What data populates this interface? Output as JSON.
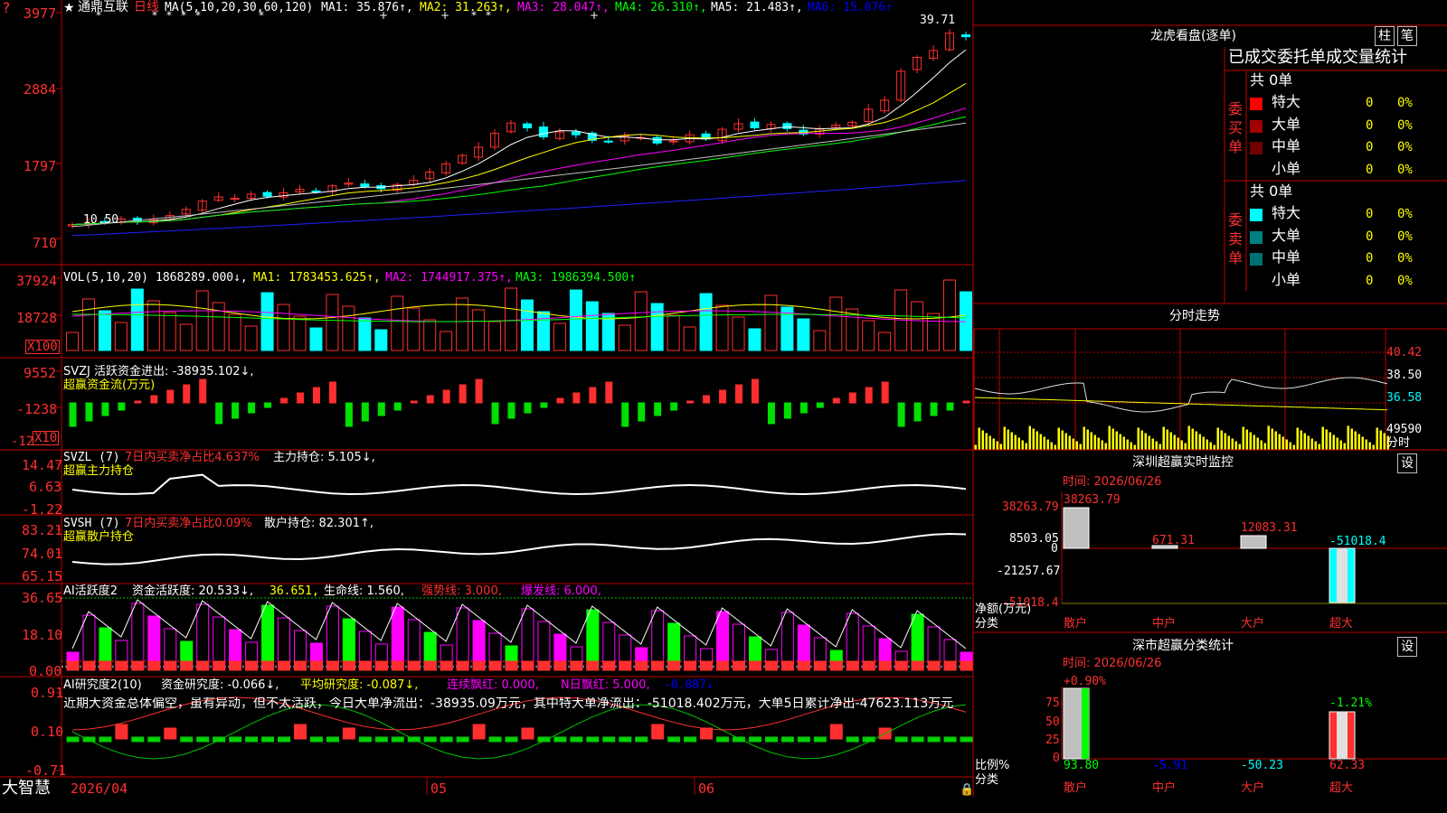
{
  "app": {
    "brand": "大智慧",
    "corner_mark": "?",
    "lock_icon": "lock-icon"
  },
  "header": {
    "star": "★",
    "stock_name": "通鼎互联",
    "period": "日线",
    "ma_label": "MA(5,10,20,30,60,120)",
    "ma1": "MA1: 35.876↑,",
    "ma2": "MA2: 31.263↑,",
    "ma3": "MA3: 28.047↑,",
    "ma4": "MA4: 26.310↑,",
    "ma5": "MA5: 21.483↑,",
    "ma6": "MA6: 15.076↑",
    "high_label": "39.71",
    "low_label": "10.50"
  },
  "price_axis": [
    "3977",
    "2884",
    "1797",
    "710"
  ],
  "vol_panel": {
    "title": "VOL(5,10,20)",
    "value": "1868289.000↓,",
    "ma1": "MA1: 1783453.625↑,",
    "ma2": "MA2: 1744917.375↑,",
    "ma3": "MA3: 1986394.500↑",
    "axis": [
      "37924",
      "18728"
    ],
    "unit": "X100"
  },
  "svzj_panel": {
    "title": "SVZJ  活跃资金进出: -38935.102↓,",
    "subtitle": "超赢资金流(万元)",
    "axis": [
      "9552",
      "-1238",
      "-12"
    ],
    "unit": "X10"
  },
  "svzl_panel": {
    "title": "SVZL (7)",
    "desc": "7日内买卖净占比4.637%",
    "hold": "主力持仓: 5.105↓,",
    "subtitle": "超赢主力持仓",
    "axis": [
      "14.47",
      "6.63",
      "-1.22"
    ]
  },
  "svsh_panel": {
    "title": "SVSH (7)",
    "desc": "7日内买卖净占比0.09%",
    "hold": "散户持仓: 82.301↑,",
    "subtitle": "超赢散户持仓",
    "axis": [
      "83.21",
      "74.01",
      "65.15"
    ]
  },
  "ai_active_panel": {
    "title": "AI活跃度2",
    "v1": "资金活跃度: 20.533↓,",
    "v2": "36.651,",
    "v3": "生命线: 1.560,",
    "v4": "强势线: 3.000,",
    "v5": "爆发线: 6.000,",
    "axis": [
      "36.65",
      "18.10",
      "0.00"
    ]
  },
  "ai_research_panel": {
    "title": "AI研究度2(10)",
    "v1": "资金研究度: -0.066↓,",
    "v2": "平均研究度: -0.087↓,",
    "v3": "连续飘红: 0.000,",
    "v4": "N日飘红: 5.000,",
    "v5": "-0.087↓",
    "note": "近期大资金总体偏空，虽有异动，但不太活跃，今日大单净流出：-38935.09万元，其中特大单净流出：-51018.402万元，大单5日累计净出-47623.113万元",
    "axis": [
      "0.91",
      "0.10",
      "-0.71"
    ]
  },
  "date_axis": [
    "2026/04",
    "05",
    "06"
  ],
  "right": {
    "lhb_title": "龙虎看盘(逐单)",
    "btn_zhu": "柱",
    "btn_bi": "笔",
    "stats_title": "已成交委托单成交量统计",
    "buy_label": "委买单",
    "sell_label": "委卖单",
    "buy_total": "共 0单",
    "sell_total": "共 0单",
    "buy_rows": [
      {
        "label": "特大",
        "count": "0",
        "pct": "0%",
        "color": "#ff0000"
      },
      {
        "label": "大单",
        "count": "0",
        "pct": "0%",
        "color": "#a00000"
      },
      {
        "label": "中单",
        "count": "0",
        "pct": "0%",
        "color": "#700000"
      },
      {
        "label": "小单",
        "count": "0",
        "pct": "0%",
        "color": ""
      }
    ],
    "sell_rows": [
      {
        "label": "特大",
        "count": "0",
        "pct": "0%",
        "color": "#00ffff"
      },
      {
        "label": "大单",
        "count": "0",
        "pct": "0%",
        "color": "#008080"
      },
      {
        "label": "中单",
        "count": "0",
        "pct": "0%",
        "color": "#007070"
      },
      {
        "label": "小单",
        "count": "0",
        "pct": "0%",
        "color": ""
      }
    ],
    "intraday_title": "分时走势",
    "intraday_axis": [
      "40.42",
      "38.50",
      "36.58",
      "49590"
    ],
    "intraday_footer": "分时",
    "sz_monitor_title": "深圳超赢实时监控",
    "sz_monitor_btn": "设",
    "sz_monitor_time": "时间: 2026/06/26",
    "sz_monitor_axis": [
      "38263.79",
      "8503.05",
      "0",
      "-21257.67",
      "-51018.4"
    ],
    "sz_monitor_values": [
      "38263.79",
      "671.31",
      "12083.31",
      "-51018.4"
    ],
    "sz_monitor_ylabel": "净额(万元)",
    "sz_monitor_xlabel": "分类",
    "categories": [
      "散户",
      "中户",
      "大户",
      "超大"
    ],
    "sz_class_title": "深市超赢分类统计",
    "sz_class_btn": "设",
    "sz_class_time": "时间: 2026/06/26",
    "sz_class_axis": [
      "75",
      "50",
      "25",
      "0"
    ],
    "sz_class_top": [
      "+0.90%",
      "-1.21%"
    ],
    "sz_class_values": [
      "93.80",
      "-5.91",
      "-50.23",
      "62.33"
    ],
    "sz_class_ylabel": "比例%",
    "sz_class_xlabel": "分类"
  },
  "chart_data": {
    "type": "candlestick",
    "title": "通鼎互联 日线",
    "close": [
      10.8,
      11.0,
      11.2,
      11.6,
      11.3,
      11.5,
      12.1,
      13.0,
      14.2,
      14.8,
      14.6,
      15.2,
      14.9,
      15.4,
      15.9,
      15.6,
      16.4,
      16.8,
      16.3,
      16.0,
      16.6,
      17.2,
      18.4,
      19.6,
      20.8,
      22.0,
      24.0,
      25.5,
      24.8,
      23.5,
      24.2,
      23.8,
      23.0,
      22.8,
      23.6,
      23.4,
      22.6,
      22.9,
      23.8,
      23.2,
      24.6,
      25.4,
      24.8,
      25.3,
      24.7,
      23.9,
      24.6,
      25.2,
      25.6,
      27.5,
      28.8,
      33.0,
      35.0,
      36.0,
      38.5,
      38.0
    ],
    "ma_series": [
      "MA1",
      "MA2",
      "MA3",
      "MA4",
      "MA5",
      "MA6"
    ],
    "vol_ma": [
      "MA1",
      "MA2",
      "MA3"
    ]
  }
}
